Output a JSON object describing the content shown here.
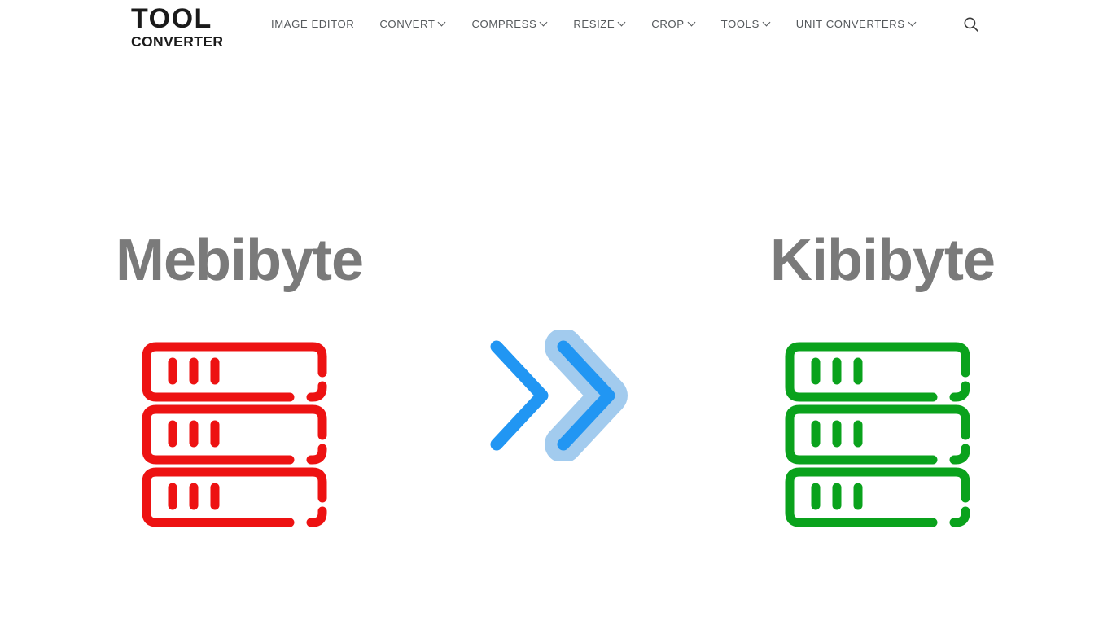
{
  "header": {
    "logo": {
      "line1": "TOOL",
      "line2": "CONVERTER",
      "name": "Tool Converter"
    },
    "nav": [
      {
        "label": "IMAGE EDITOR",
        "has_dropdown": false
      },
      {
        "label": "CONVERT",
        "has_dropdown": true
      },
      {
        "label": "COMPRESS",
        "has_dropdown": true
      },
      {
        "label": "RESIZE",
        "has_dropdown": true
      },
      {
        "label": "CROP",
        "has_dropdown": true
      },
      {
        "label": "TOOLS",
        "has_dropdown": true
      },
      {
        "label": "UNIT CONVERTERS",
        "has_dropdown": true
      }
    ],
    "search": {
      "icon": "search-icon",
      "aria_label": "Search"
    }
  },
  "conversion": {
    "source": {
      "title": "Mebibyte",
      "icon": "server-stack-icon",
      "color": "#ED1212"
    },
    "arrow": {
      "icon": "double-chevron-right-icon",
      "stroke_color": "#2196F3",
      "fill_color": "#A2CBEE"
    },
    "target": {
      "title": "Kibibyte",
      "icon": "server-stack-icon",
      "color": "#0AA21C"
    }
  },
  "theme": {
    "background": "#FFFFFF",
    "title_color": "#7A7A7A",
    "nav_color": "#55595C",
    "logo_color": "#1A1A1A"
  }
}
